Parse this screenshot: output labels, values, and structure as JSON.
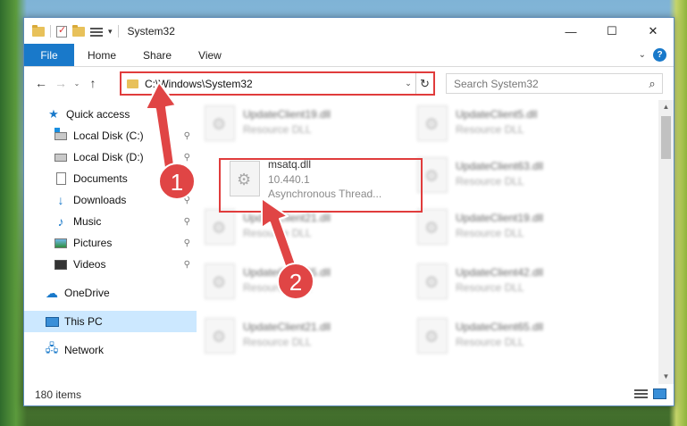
{
  "window": {
    "title": "System32",
    "controls": {
      "minimize": "—",
      "maximize": "☐",
      "close": "✕"
    }
  },
  "ribbon": {
    "tabs": [
      "File",
      "Home",
      "Share",
      "View"
    ],
    "collapse_glyph": "⌄",
    "help_glyph": "?"
  },
  "nav": {
    "back": "←",
    "forward": "→",
    "recent": "⌄",
    "up": "↑",
    "address": "C:\\Windows\\System32",
    "address_dropdown": "⌄",
    "refresh": "↻",
    "search_placeholder": "Search System32",
    "search_glyph": "⌕"
  },
  "sidebar": {
    "items": [
      {
        "label": "Quick access",
        "icon": "star-icon"
      },
      {
        "label": "Local Disk (C:)",
        "icon": "disk-icon",
        "pinned": true
      },
      {
        "label": "Local Disk (D:)",
        "icon": "disk-icon",
        "pinned": true
      },
      {
        "label": "Documents",
        "icon": "documents-icon",
        "pinned": true
      },
      {
        "label": "Downloads",
        "icon": "download-icon",
        "pinned": true
      },
      {
        "label": "Music",
        "icon": "music-icon",
        "pinned": true
      },
      {
        "label": "Pictures",
        "icon": "pictures-icon",
        "pinned": true
      },
      {
        "label": "Videos",
        "icon": "videos-icon",
        "pinned": true
      },
      {
        "label": "OneDrive",
        "icon": "cloud-icon"
      },
      {
        "label": "This PC",
        "icon": "computer-icon",
        "selected": true
      },
      {
        "label": "Network",
        "icon": "network-icon"
      }
    ],
    "pin_glyph": "📌"
  },
  "files": {
    "col1": [
      {
        "name": "UpdateClient19.dll",
        "desc": "Resource DLL"
      },
      {
        "name": "msatq.dll",
        "version": "10.440.1",
        "desc": "Asynchronous Thread..."
      },
      {
        "name": "UpdateClient21.dll",
        "desc": "Resource DLL"
      },
      {
        "name": "UpdateClient65.dll",
        "desc": "Resource DLL"
      },
      {
        "name": "UpdateClient21.dll",
        "desc": "Resource DLL"
      }
    ],
    "col2": [
      {
        "name": "UpdateClient5.dll",
        "desc": "Resource DLL"
      },
      {
        "name": "UpdateClient63.dll",
        "desc": "Resource DLL"
      },
      {
        "name": "UpdateClient19.dll",
        "desc": "Resource DLL"
      },
      {
        "name": "UpdateClient42.dll",
        "desc": "Resource DLL"
      },
      {
        "name": "UpdateClient65.dll",
        "desc": "Resource DLL"
      }
    ]
  },
  "status": {
    "item_count": "180 items"
  },
  "annotations": {
    "step1": "1",
    "step2": "2"
  },
  "colors": {
    "accent": "#1979ca",
    "highlight_red": "#e03c3c",
    "selected_bg": "#cce8ff"
  }
}
